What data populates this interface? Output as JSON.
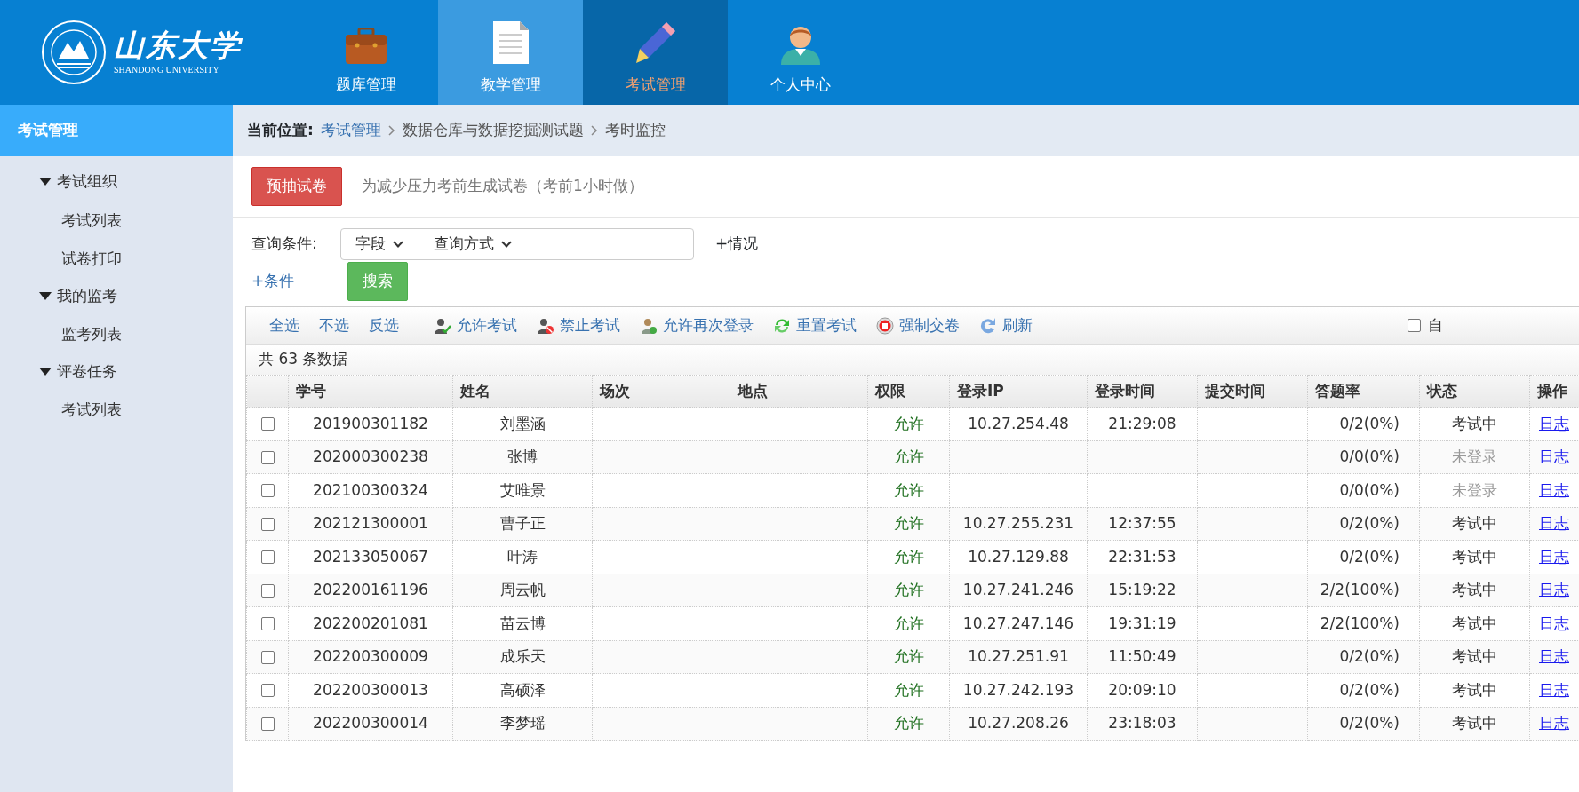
{
  "logo": {
    "name": "山东大学",
    "subtitle": "SHANDONG UNIVERSITY"
  },
  "nav": [
    {
      "label": "题库管理",
      "selected": false,
      "hovered": false
    },
    {
      "label": "教学管理",
      "selected": false,
      "hovered": true
    },
    {
      "label": "考试管理",
      "selected": true,
      "hovered": false
    },
    {
      "label": "个人中心",
      "selected": false,
      "hovered": false
    }
  ],
  "sidebar": {
    "title": "考试管理",
    "groups": [
      {
        "label": "考试组织",
        "expanded": true,
        "children": [
          {
            "label": "考试列表"
          },
          {
            "label": "试卷打印"
          }
        ]
      },
      {
        "label": "我的监考",
        "expanded": true,
        "children": [
          {
            "label": "监考列表"
          }
        ]
      },
      {
        "label": "评卷任务",
        "expanded": true,
        "children": [
          {
            "label": "考试列表"
          }
        ]
      }
    ]
  },
  "breadcrumb": {
    "label": "当前位置:",
    "items": [
      {
        "text": "考试管理",
        "link": true
      },
      {
        "text": "数据仓库与数据挖掘测试题",
        "link": false
      },
      {
        "text": "考时监控",
        "link": false
      }
    ]
  },
  "pre_draw": {
    "button": "预抽试卷",
    "note": "为减少压力考前生成试卷（考前1小时做）"
  },
  "query": {
    "label": "查询条件:",
    "field_select": "字段",
    "method_select": "查询方式",
    "add_status": "+情况",
    "add_condition": "+条件",
    "search_button": "搜索"
  },
  "toolbar": {
    "select": [
      {
        "label": "全选"
      },
      {
        "label": "不选"
      },
      {
        "label": "反选"
      }
    ],
    "actions": [
      {
        "label": "允许考试"
      },
      {
        "label": "禁止考试"
      },
      {
        "label": "允许再次登录"
      },
      {
        "label": "重置考试"
      },
      {
        "label": "强制交卷"
      },
      {
        "label": "刷新"
      }
    ],
    "auto": {
      "label": "自",
      "checked": false
    }
  },
  "count": "共 63 条数据",
  "table": {
    "columns": [
      "学号",
      "姓名",
      "场次",
      "地点",
      "权限",
      "登录IP",
      "登录时间",
      "提交时间",
      "答题率",
      "状态",
      "操作"
    ],
    "rows": [
      {
        "checked": false,
        "id": "201900301182",
        "name": "刘墨涵",
        "permission": "允许",
        "ip": "10.27.254.48",
        "login_time": "21:29:08",
        "rate": "0/2(0%)",
        "status": "考试中",
        "greyed": false,
        "action": "日志"
      },
      {
        "checked": false,
        "id": "202000300238",
        "name": "张博",
        "permission": "允许",
        "rate": "0/0(0%)",
        "status": "未登录",
        "greyed": true,
        "action": "日志"
      },
      {
        "checked": false,
        "id": "202100300324",
        "name": "艾唯景",
        "permission": "允许",
        "rate": "0/0(0%)",
        "status": "未登录",
        "greyed": true,
        "action": "日志"
      },
      {
        "checked": false,
        "id": "202121300001",
        "name": "曹子正",
        "permission": "允许",
        "ip": "10.27.255.231",
        "login_time": "12:37:55",
        "rate": "0/2(0%)",
        "status": "考试中",
        "greyed": false,
        "action": "日志"
      },
      {
        "checked": false,
        "id": "202133050067",
        "name": "叶涛",
        "permission": "允许",
        "ip": "10.27.129.88",
        "login_time": "22:31:53",
        "rate": "0/2(0%)",
        "status": "考试中",
        "greyed": false,
        "action": "日志"
      },
      {
        "checked": false,
        "id": "202200161196",
        "name": "周云帆",
        "permission": "允许",
        "ip": "10.27.241.246",
        "login_time": "15:19:22",
        "rate": "2/2(100%)",
        "status": "考试中",
        "greyed": false,
        "action": "日志"
      },
      {
        "checked": false,
        "id": "202200201081",
        "name": "苗云博",
        "permission": "允许",
        "ip": "10.27.247.146",
        "login_time": "19:31:19",
        "rate": "2/2(100%)",
        "status": "考试中",
        "greyed": false,
        "action": "日志"
      },
      {
        "checked": false,
        "id": "202200300009",
        "name": "成乐天",
        "permission": "允许",
        "ip": "10.27.251.91",
        "login_time": "11:50:49",
        "rate": "0/2(0%)",
        "status": "考试中",
        "greyed": false,
        "action": "日志"
      },
      {
        "checked": false,
        "id": "202200300013",
        "name": "高硕泽",
        "permission": "允许",
        "ip": "10.27.242.193",
        "login_time": "20:09:10",
        "rate": "0/2(0%)",
        "status": "考试中",
        "greyed": false,
        "action": "日志"
      },
      {
        "checked": false,
        "id": "202200300014",
        "name": "李梦瑶",
        "permission": "允许",
        "ip": "10.27.208.26",
        "login_time": "23:18:03",
        "rate": "0/2(0%)",
        "status": "考试中",
        "greyed": false,
        "action": "日志"
      }
    ]
  }
}
